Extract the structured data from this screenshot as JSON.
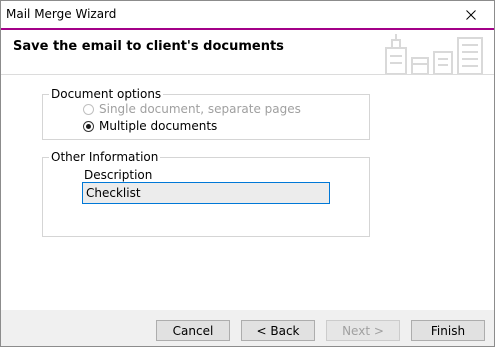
{
  "window": {
    "title": "Mail Merge Wizard"
  },
  "header": {
    "title": "Save the email to client's documents",
    "accent_color": "#a30088"
  },
  "document_options": {
    "legend": "Document options",
    "options": [
      {
        "label": "Single document, separate pages",
        "selected": false,
        "enabled": false
      },
      {
        "label": "Multiple documents",
        "selected": true,
        "enabled": true
      }
    ]
  },
  "other_information": {
    "legend": "Other Information",
    "description_label": "Description",
    "description_value": "Checklist"
  },
  "footer": {
    "cancel_label": "Cancel",
    "back_label": "< Back",
    "next_label": "Next >",
    "finish_label": "Finish"
  }
}
